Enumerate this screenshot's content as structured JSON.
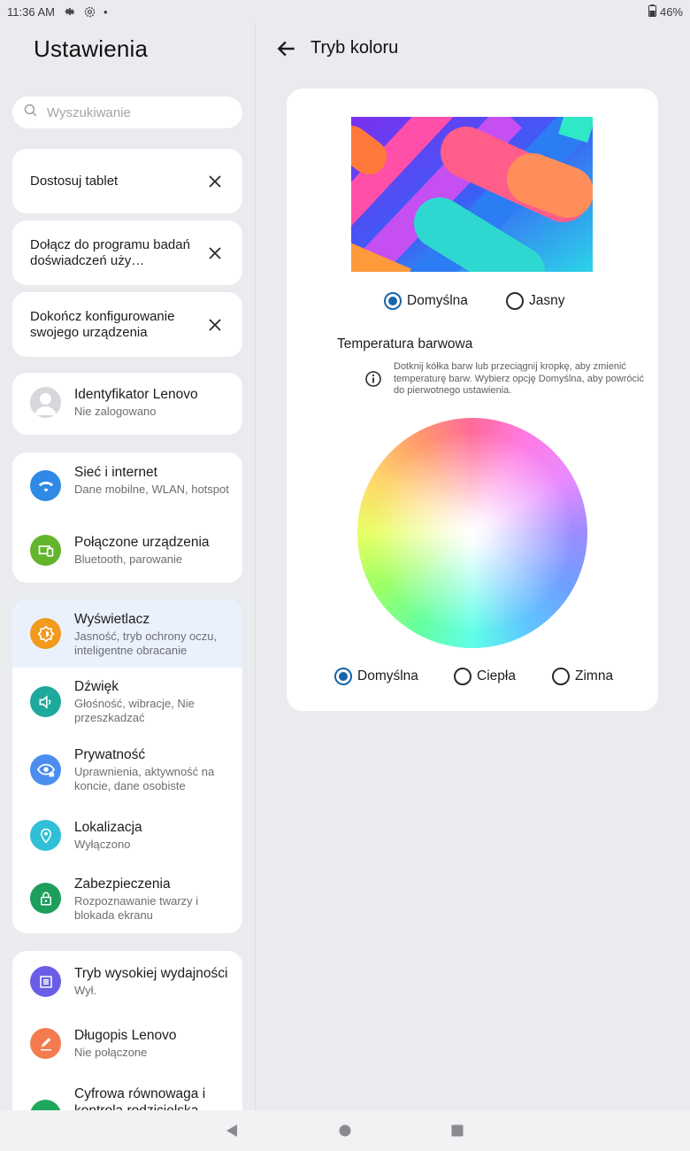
{
  "status": {
    "time": "11:36 AM",
    "battery": "46%",
    "dot": "•"
  },
  "left": {
    "title": "Ustawienia",
    "search_placeholder": "Wyszukiwanie",
    "suggestions": [
      {
        "label": "Dostosuj tablet"
      },
      {
        "label": "Dołącz do programu badań doświadczeń uży…"
      },
      {
        "label": "Dokończ konfigurowanie swojego urządzenia"
      }
    ],
    "account": {
      "title": "Identyfikator Lenovo",
      "subtitle": "Nie zalogowano"
    },
    "group1": [
      {
        "title": "Sieć i internet",
        "subtitle": "Dane mobilne, WLAN, hotspot",
        "icon": "wifi-icon",
        "color": "#2f8ae6"
      },
      {
        "title": "Połączone urządzenia",
        "subtitle": "Bluetooth, parowanie",
        "icon": "devices-icon",
        "color": "#63b52c"
      }
    ],
    "group2": [
      {
        "title": "Wyświetlacz",
        "subtitle": "Jasność, tryb ochrony oczu, inteligentne obracanie",
        "icon": "brightness-icon",
        "color": "#f29a1c"
      },
      {
        "title": "Dźwięk",
        "subtitle": "Głośność, wibracje, Nie przeszkadzać",
        "icon": "volume-icon",
        "color": "#1fa99c"
      },
      {
        "title": "Prywatność",
        "subtitle": "Uprawnienia, aktywność na koncie, dane osobiste",
        "icon": "eye-lock-icon",
        "color": "#4b8ef0"
      },
      {
        "title": "Lokalizacja",
        "subtitle": "Wyłączono",
        "icon": "location-icon",
        "color": "#2fbfd6"
      },
      {
        "title": "Zabezpieczenia",
        "subtitle": "Rozpoznawanie twarzy i blokada ekranu",
        "icon": "lock-icon",
        "color": "#1e9e5c"
      }
    ],
    "group3": [
      {
        "title": "Tryb wysokiej wydajności",
        "subtitle": "Wył.",
        "icon": "performance-icon",
        "color": "#6a5ee8"
      },
      {
        "title": "Długopis Lenovo",
        "subtitle": "Nie połączone",
        "icon": "pen-icon",
        "color": "#f47b4f"
      },
      {
        "title": "Cyfrowa równowaga i kontrola rodzicielska",
        "subtitle": "",
        "icon": "wellbeing-icon",
        "color": "#1ea95a"
      }
    ]
  },
  "right": {
    "title": "Tryb koloru",
    "mode_options": [
      {
        "label": "Domyślna",
        "selected": true
      },
      {
        "label": "Jasny",
        "selected": false
      }
    ],
    "temperature_title": "Temperatura barwowa",
    "info": "Dotknij kółka barw lub przeciągnij kropkę, aby zmienić temperaturę barw. Wybierz opcję Domyślna, aby powrócić do pierwotnego ustawienia.",
    "temp_options": [
      {
        "label": "Domyślna",
        "selected": true
      },
      {
        "label": "Ciepła",
        "selected": false
      },
      {
        "label": "Zimna",
        "selected": false
      }
    ]
  },
  "colors": {
    "accent": "#1565a8",
    "background": "#eaebef",
    "card": "#ffffff",
    "active_item": "#eaf1fd"
  }
}
